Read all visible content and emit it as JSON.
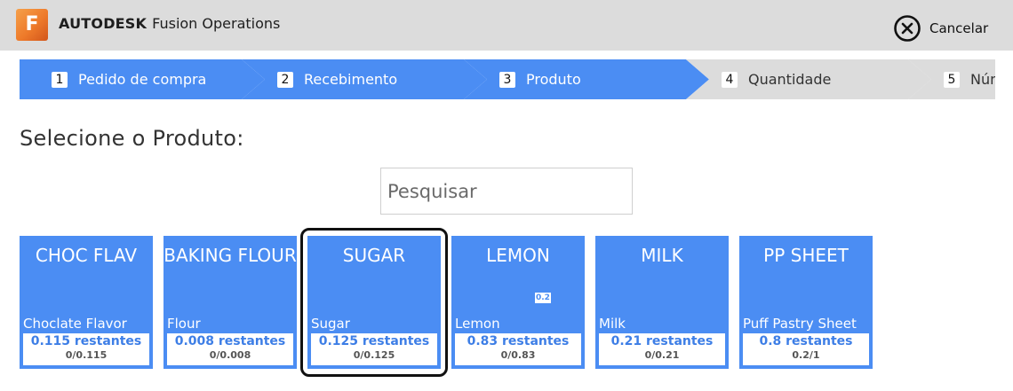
{
  "header": {
    "brand": "AUTODESK",
    "product": "Fusion Operations",
    "logo_letter": "F",
    "cancel_label": "Cancelar",
    "cancel_icon": "circle-x-icon"
  },
  "steps": [
    {
      "number": "1",
      "label": "Pedido de compra",
      "state": "done"
    },
    {
      "number": "2",
      "label": "Recebimento",
      "state": "done"
    },
    {
      "number": "3",
      "label": "Produto",
      "state": "current"
    },
    {
      "number": "4",
      "label": "Quantidade",
      "state": "todo"
    },
    {
      "number": "5",
      "label": "Núm",
      "state": "todo"
    }
  ],
  "page": {
    "title": "Selecione o Produto:",
    "search_placeholder": "Pesquisar"
  },
  "products": [
    {
      "title": "CHOC FLAV",
      "name": "Choclate Flavor",
      "remaining": "0.115 restantes",
      "ratio": "0/0.115"
    },
    {
      "title": "BAKING FLOUR",
      "name": "Flour",
      "remaining": "0.008 restantes",
      "ratio": "0/0.008"
    },
    {
      "title": "SUGAR",
      "name": "Sugar",
      "remaining": "0.125 restantes",
      "ratio": "0/0.125",
      "selected": true
    },
    {
      "title": "LEMON",
      "name": "Lemon",
      "remaining": "0.83 restantes",
      "ratio": "0/0.83",
      "badge": "0.2"
    },
    {
      "title": "MILK",
      "name": "Milk",
      "remaining": "0.21 restantes",
      "ratio": "0/0.21"
    },
    {
      "title": "PP SHEET",
      "name": "Puff Pastry Sheet",
      "remaining": "0.8 restantes",
      "ratio": "0.2/1"
    }
  ],
  "colors": {
    "header_bg": "#dcdcdc",
    "step_active": "#4b8df3",
    "step_inactive": "#dcdcdc",
    "card_bg": "#4b8df3",
    "card_accent": "#3d7ee6",
    "selected_outline": "#111111",
    "logo_orange": "#ee7a2a"
  }
}
